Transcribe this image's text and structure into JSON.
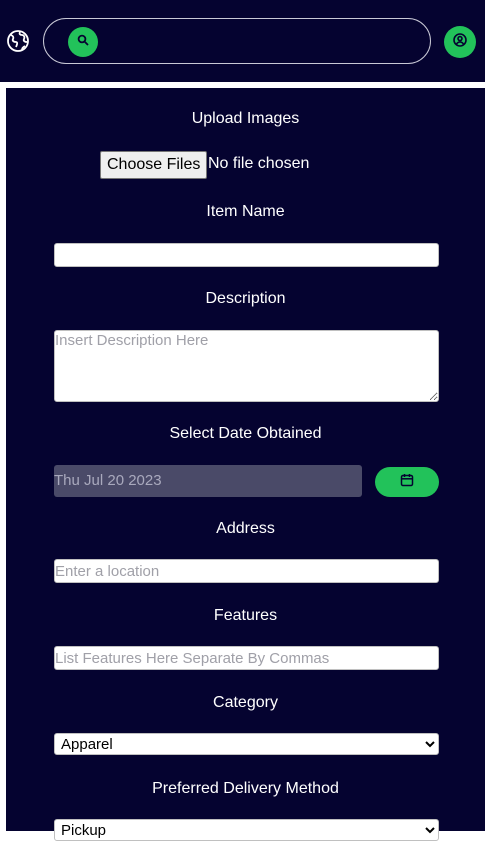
{
  "header": {
    "globe_icon": "globe-icon",
    "search": {
      "placeholder": "",
      "icon": "search-icon"
    },
    "profile_icon": "user-circle-icon"
  },
  "form": {
    "upload_label": "Upload Images",
    "choose_files_button": "Choose Files",
    "file_status": "No file chosen",
    "item_name_label": "Item Name",
    "item_name_value": "",
    "description_label": "Description",
    "description_placeholder": "Insert Description Here",
    "date_label": "Select Date Obtained",
    "date_value": "Thu Jul 20 2023",
    "date_icon": "calendar-icon",
    "address_label": "Address",
    "address_placeholder": "Enter a location",
    "features_label": "Features",
    "features_placeholder": "List Features Here Separate By Commas",
    "category_label": "Category",
    "category_selected": "Apparel",
    "delivery_label": "Preferred Delivery Method",
    "delivery_selected": "Pickup"
  },
  "colors": {
    "background": "#050330",
    "accent": "#22c25a"
  }
}
